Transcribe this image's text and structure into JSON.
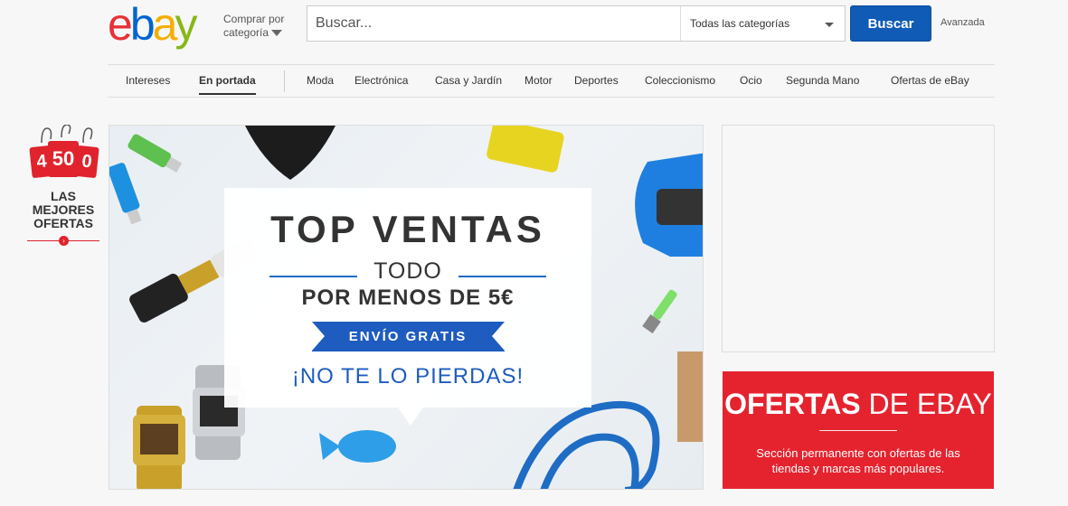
{
  "header": {
    "logo": {
      "letters": [
        "e",
        "b",
        "a",
        "y"
      ],
      "colors": [
        "#e53238",
        "#0064d2",
        "#f5af02",
        "#86b817"
      ]
    },
    "shop_by_category": "Comprar por categoría",
    "search": {
      "placeholder": "Buscar...",
      "category_selected": "Todas las categorías",
      "button_label": "Buscar"
    },
    "advanced_label": "Avanzada"
  },
  "nav": {
    "items": [
      {
        "label": "Intereses"
      },
      {
        "label": "En portada"
      },
      {
        "label": "Moda"
      },
      {
        "label": "Electrónica"
      },
      {
        "label": "Casa y Jardín"
      },
      {
        "label": "Motor"
      },
      {
        "label": "Deportes"
      },
      {
        "label": "Coleccionismo"
      },
      {
        "label": "Ocio"
      },
      {
        "label": "Segunda Mano"
      },
      {
        "label": "Ofertas de eBay"
      }
    ],
    "active": "En portada"
  },
  "deals_badge": {
    "tags": [
      "4",
      "50",
      "0"
    ],
    "text_line1": "LAS MEJORES",
    "text_line2": "OFERTAS",
    "arrow_icon": "chevron-right-icon"
  },
  "banner": {
    "title": "TOP VENTAS",
    "subtitle": "TODO",
    "subtitle2": "POR MENOS DE 5€",
    "ribbon": "ENVÍO GRATIS",
    "cta": "¡NO TE LO PIERDAS!",
    "accent": "#1e5cbf"
  },
  "offers_panel": {
    "title_bold": "OFERTAS",
    "title_rest": " DE EBAY",
    "description": "Sección permanente con ofertas de las tiendas y marcas más populares.",
    "color": "#e5232e"
  }
}
